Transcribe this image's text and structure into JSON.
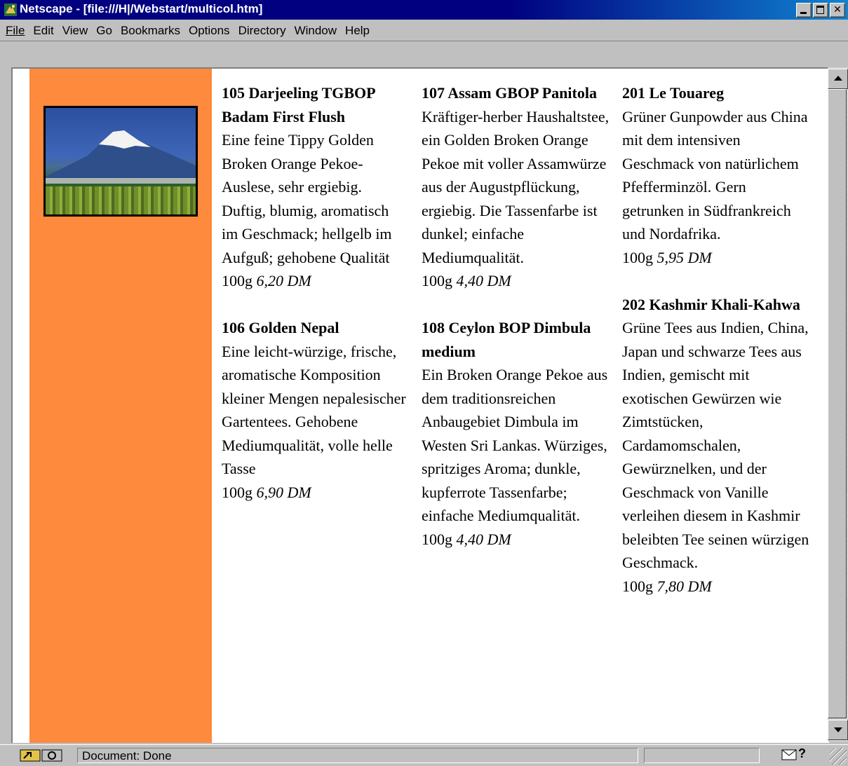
{
  "window": {
    "title": "Netscape - [file:///H|/Webstart/multicol.htm]"
  },
  "menu": [
    "File",
    "Edit",
    "View",
    "Go",
    "Bookmarks",
    "Options",
    "Directory",
    "Window",
    "Help"
  ],
  "colors": {
    "sidebar": "#fd8a3d",
    "titlebar": "#000080"
  },
  "teas": {
    "c1": [
      {
        "title": "105 Darjeeling TGBOP Badam First Flush",
        "desc": "Eine feine Tippy Golden Broken Orange Pekoe-Auslese, sehr ergiebig. Duftig, blumig, aromatisch im Geschmack; hellgelb im Aufguß; gehobene Qualität",
        "qty": "100g",
        "price": "6,20 DM"
      },
      {
        "title": "106 Golden Nepal",
        "desc": "Eine leicht-würzige, frische, aromatische Komposition kleiner Mengen nepalesischer Gartentees. Gehobene Mediumqualität, volle helle Tasse",
        "qty": "100g",
        "price": "6,90 DM"
      }
    ],
    "c2": [
      {
        "title": "107 Assam GBOP Panitola",
        "desc": "Kräftiger-herber Haushaltstee, ein Golden Broken Orange Pekoe mit voller Assamwürze aus der Augustpflückung, ergiebig. Die Tassenfarbe ist dunkel; einfache Mediumqualität.",
        "qty": "100g",
        "price": "4,40 DM"
      },
      {
        "title": "108 Ceylon BOP Dimbula medium",
        "desc": "Ein Broken Orange Pekoe aus dem traditionsreichen Anbaugebiet Dimbula im Westen Sri Lankas. Würziges, spritziges Aroma; dunkle, kupferrote Tassenfarbe; einfache Mediumqualität.",
        "qty": "100g",
        "price": "4,40 DM"
      }
    ],
    "c3": [
      {
        "title": "201 Le Touareg",
        "desc": "Grüner Gunpowder aus China mit dem intensiven Geschmack von natürlichem Pfefferminzöl. Gern getrunken in Südfrankreich und Nordafrika.",
        "qty": "100g",
        "price": "5,95 DM"
      },
      {
        "title": "202 Kashmir Khali-Kahwa",
        "desc": "Grüne Tees aus Indien, China, Japan und schwarze Tees aus Indien, gemischt mit exotischen Gewürzen wie Zimtstücken, Cardamomschalen, Gewürznelken, und der Geschmack von Vanille verleihen diesem in Kashmir beleibten Tee seinen würzigen Geschmack.",
        "qty": "100g",
        "price": "7,80 DM"
      }
    ]
  },
  "status": {
    "text": "Document: Done"
  }
}
